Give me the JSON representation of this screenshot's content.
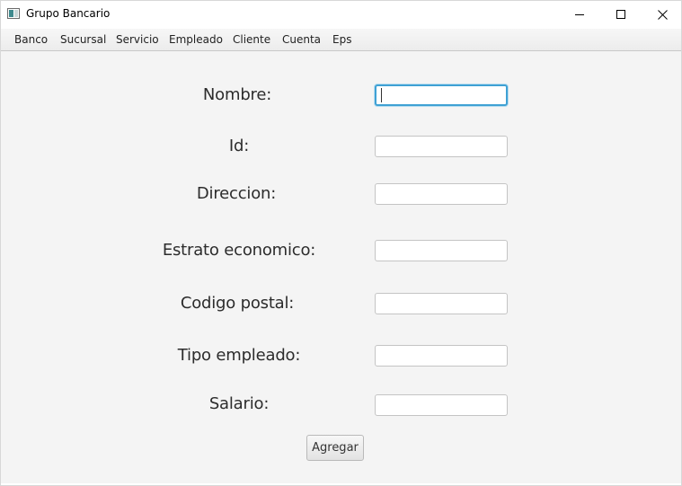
{
  "window": {
    "title": "Grupo Bancario"
  },
  "menu": {
    "items": [
      "Banco",
      "Sucursal",
      "Servicio",
      "Empleado",
      "Cliente",
      "Cuenta",
      "Eps"
    ]
  },
  "form": {
    "fields": [
      {
        "label": "Nombre:",
        "value": ""
      },
      {
        "label": "Id:",
        "value": ""
      },
      {
        "label": "Direccion:",
        "value": ""
      },
      {
        "label": "Estrato economico:",
        "value": ""
      },
      {
        "label": "Codigo postal:",
        "value": ""
      },
      {
        "label": "Tipo empleado:",
        "value": ""
      },
      {
        "label": "Salario:",
        "value": ""
      }
    ],
    "submit_label": "Agregar"
  },
  "icons": {
    "app": "app-window-icon",
    "minimize": "minimize-icon",
    "maximize": "maximize-icon",
    "close": "close-icon"
  },
  "colors": {
    "focus_border": "#3fa1d4",
    "window_background": "#f4f4f4"
  }
}
